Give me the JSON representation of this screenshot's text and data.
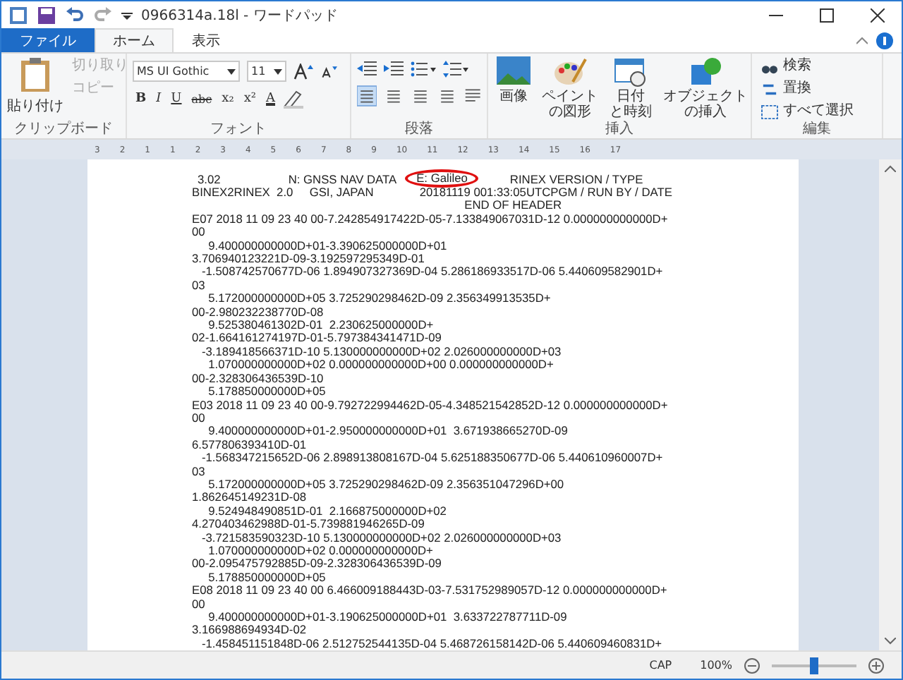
{
  "window": {
    "title": "0966314a.18l - ワードパッド"
  },
  "tabs": [
    {
      "label": "ファイル",
      "kind": "file",
      "selected": false
    },
    {
      "label": "ホーム",
      "kind": "tab",
      "selected": true
    },
    {
      "label": "表示",
      "kind": "tab",
      "selected": false
    }
  ],
  "ribbon": {
    "clipboard": {
      "paste": "貼り付け",
      "items": [
        {
          "label": "切り取り",
          "disabled": true
        },
        {
          "label": "コピー",
          "disabled": true
        }
      ],
      "label": "クリップボード"
    },
    "font": {
      "family": "MS UI Gothic",
      "size": "11",
      "format_buttons": [
        "B",
        "I",
        "U",
        "abc",
        "x₂",
        "x²",
        "A"
      ],
      "label": "フォント"
    },
    "paragraph": {
      "align": [
        {
          "selected": true
        },
        {
          "selected": false
        },
        {
          "selected": false
        },
        {
          "selected": false
        }
      ],
      "label": "段落"
    },
    "insert": {
      "items": [
        {
          "kind": "picture",
          "lines": [
            "画像"
          ]
        },
        {
          "kind": "paint",
          "lines": [
            "ペイント",
            "の図形"
          ]
        },
        {
          "kind": "date",
          "lines": [
            "日付",
            "と時刻"
          ]
        },
        {
          "kind": "object",
          "lines": [
            "オブジェクト",
            "の挿入"
          ]
        }
      ],
      "label": "挿入"
    },
    "edit": {
      "items": [
        {
          "kind": "find",
          "label": "検索"
        },
        {
          "kind": "replace",
          "label": "置換"
        },
        {
          "kind": "select",
          "label": "すべて選択"
        }
      ],
      "label": "編集"
    }
  },
  "ruler": [
    "3",
    "2",
    "1",
    "1",
    "2",
    "3",
    "4",
    "5",
    "6",
    "7",
    "8",
    "9",
    "10",
    "11",
    "12",
    "13",
    "14",
    "15",
    "16",
    "17"
  ],
  "document": {
    "header": {
      "version": "3.02",
      "file_type": "N: GNSS NAV DATA",
      "system": "E: Galileo",
      "label": "RINEX VERSION / TYPE"
    },
    "lines": [
      "BINEX2RINEX  2.0     GSI, JAPAN              20181119 001:33:05UTCPGM / RUN BY / DATE",
      "                                                                                   END OF HEADER",
      "E07 2018 11 09 23 40 00-7.242854917422D-05-7.133849067031D-12 0.000000000000D+",
      "00",
      "     9.400000000000D+01-3.390625000000D+01",
      "3.706940123221D-09-3.192597295349D-01",
      "   -1.508742570677D-06 1.894907327369D-04 5.286186933517D-06 5.440609582901D+",
      "03",
      "     5.172000000000D+05 3.725290298462D-09 2.356349913535D+",
      "00-2.980232238770D-08",
      "     9.525380461302D-01  2.230625000000D+",
      "02-1.664161274197D-01-5.797384341471D-09",
      "   -3.189418566371D-10 5.130000000000D+02 2.026000000000D+03",
      "     1.070000000000D+02 0.000000000000D+00 0.000000000000D+",
      "00-2.328306436539D-10",
      "     5.178850000000D+05",
      "E03 2018 11 09 23 40 00-9.792722994462D-05-4.348521542852D-12 0.000000000000D+",
      "00",
      "     9.400000000000D+01-2.950000000000D+01  3.671938665270D-09",
      "6.577806393410D-01",
      "   -1.568347215652D-06 2.898913808167D-04 5.625188350677D-06 5.440610960007D+",
      "03",
      "     5.172000000000D+05 3.725290298462D-09 2.356351047296D+00",
      "1.862645149231D-08",
      "     9.524948490851D-01  2.166875000000D+02",
      "4.270403462988D-01-5.739881946265D-09",
      "   -3.721583590323D-10 5.130000000000D+02 2.026000000000D+03",
      "     1.070000000000D+02 0.000000000000D+",
      "00-2.095475792885D-09-2.328306436539D-09",
      "     5.178850000000D+05",
      "E08 2018 11 09 23 40 00 6.466009188443D-03-7.531752989057D-12 0.000000000000D+",
      "00",
      "     9.400000000000D+01-3.190625000000D+01  3.633722787711D-09",
      "3.166988694934D-02",
      "   -1.458451151848D-06 2.512752544135D-04 5.468726158142D-06 5.440609460831D+"
    ]
  },
  "status_bar": {
    "caps": "CAP",
    "zoom": "100%",
    "level": 0.5
  }
}
